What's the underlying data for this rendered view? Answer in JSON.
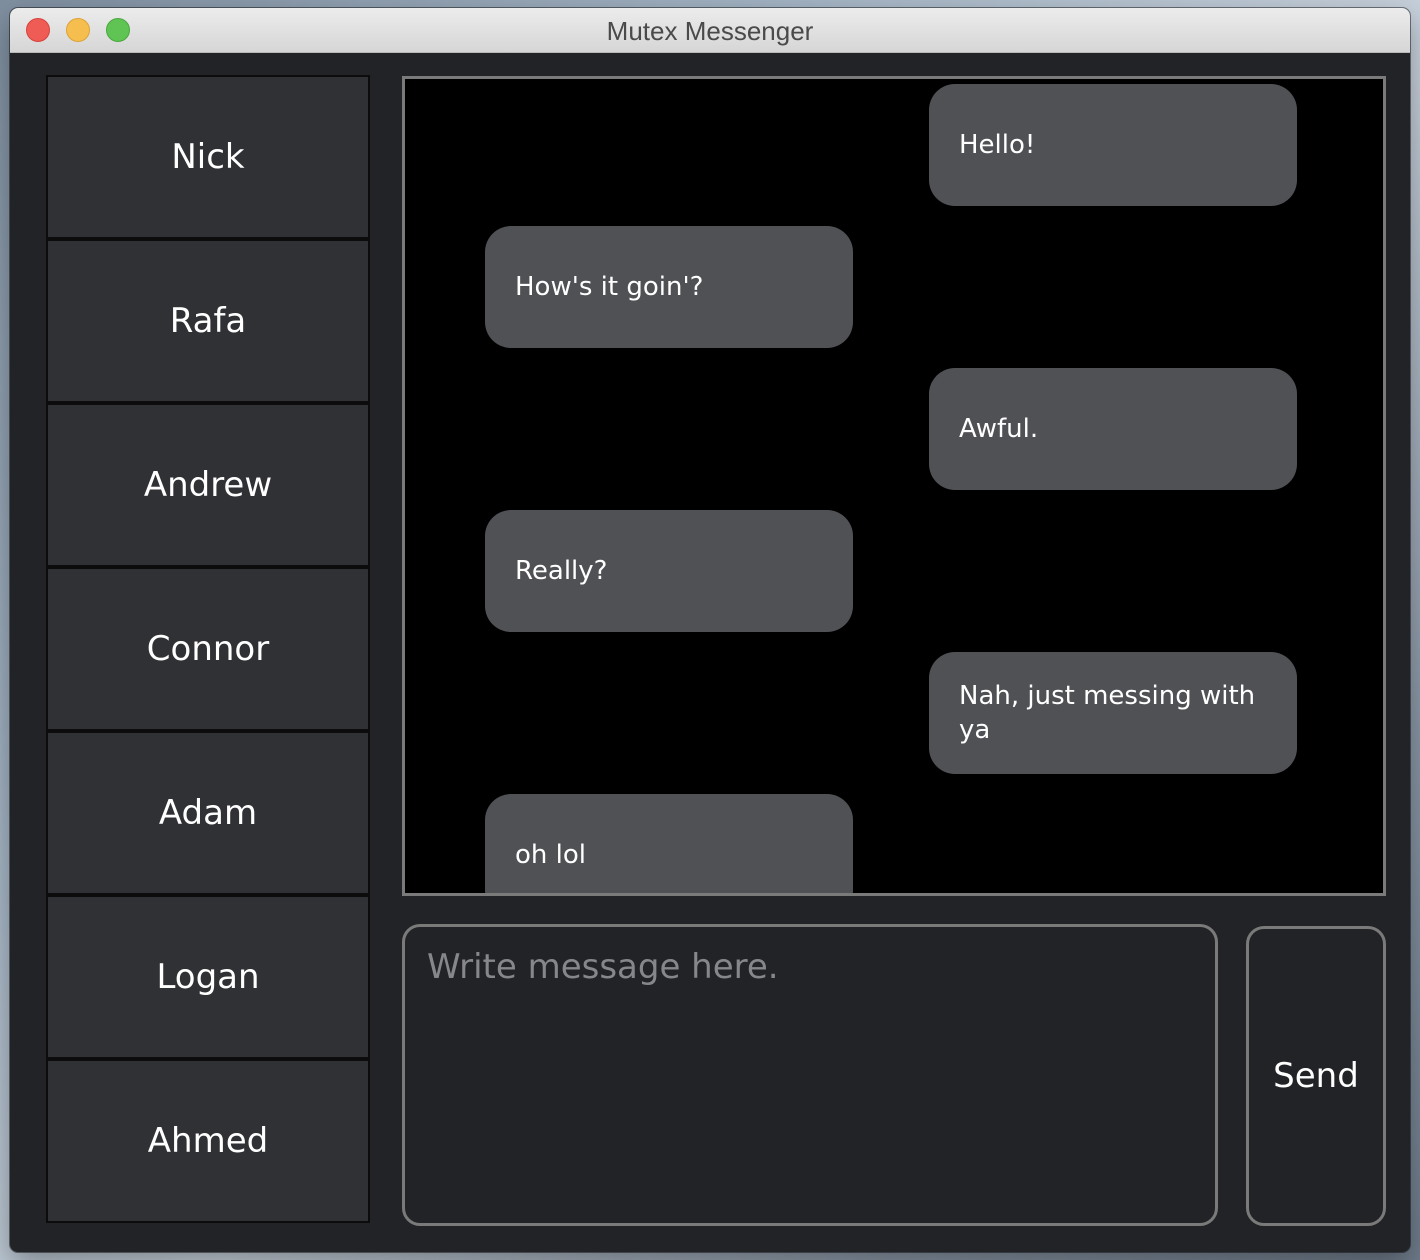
{
  "window": {
    "title": "Mutex Messenger"
  },
  "contacts": [
    {
      "name": "Nick"
    },
    {
      "name": "Rafa"
    },
    {
      "name": "Andrew"
    },
    {
      "name": "Connor"
    },
    {
      "name": "Adam"
    },
    {
      "name": "Logan"
    },
    {
      "name": "Ahmed"
    }
  ],
  "messages": [
    {
      "text": "Hello!",
      "side": "right"
    },
    {
      "text": "How's it goin'?",
      "side": "left"
    },
    {
      "text": "Awful.",
      "side": "right"
    },
    {
      "text": "Really?",
      "side": "left"
    },
    {
      "text": "Nah, just messing with ya",
      "side": "right"
    },
    {
      "text": "oh lol",
      "side": "left"
    }
  ],
  "composer": {
    "placeholder": "Write message here.",
    "value": "",
    "send_label": "Send"
  },
  "colors": {
    "window_background": "#222326",
    "contact_background": "#303135",
    "chat_background": "#000000",
    "bubble_background": "#505155",
    "border_gray": "#7a7a7a",
    "text": "#ffffff",
    "placeholder": "#86878a"
  },
  "icons": {
    "close": "close-traffic-light-icon",
    "minimize": "minimize-traffic-light-icon",
    "maximize": "maximize-traffic-light-icon"
  }
}
